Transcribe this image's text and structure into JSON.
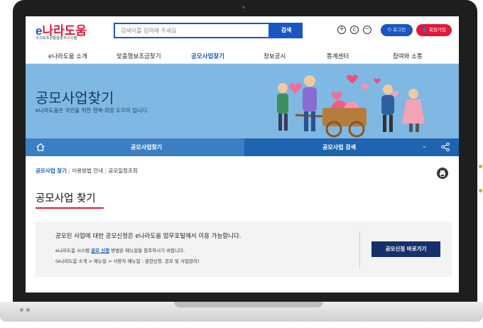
{
  "header": {
    "logo_e": "e",
    "logo_rest": "나라도움",
    "logo_sub": "국고보조금통합관리시스템",
    "search_placeholder": "검색어를 입력해 주세요",
    "search_button": "검색",
    "zoom_in": "+",
    "zoom_reset": "C",
    "zoom_out": "−",
    "login_label": "로그인",
    "join_label": "회원가입"
  },
  "gnb": {
    "items": [
      {
        "label": "e나라도움 소개"
      },
      {
        "label": "맞춤형보조금찾기"
      },
      {
        "label": "공모사업찾기"
      },
      {
        "label": "정보공시"
      },
      {
        "label": "통계센터"
      },
      {
        "label": "참여와 소통"
      }
    ],
    "active_index": 2
  },
  "banner": {
    "title": "공모사업찾기",
    "subtitle": "e나라도움은 국민을 위한 행복·희망 도우미 입니다."
  },
  "subnav": {
    "left_label": "공모사업찾기",
    "right_label": "공모사업 검색"
  },
  "breadcrumb": {
    "active": "공모사업 찾기",
    "item2": "이용방법 안내",
    "item3": "공모일정조회"
  },
  "page": {
    "title": "공모사업 찾기"
  },
  "info": {
    "line1": "공모된 사업에 대한 공모신청은 e나라도움 업무포털에서 이용 가능합니다.",
    "line2_pre": "e나라도움 시스템 ",
    "line2_link": "공모 신청",
    "line2_post": " 방법은 매뉴얼을 참조하시기 바랍니다.",
    "line3": "(e나라도움 소개 > 매뉴얼 > 사용자 매뉴얼 : 권한신청, 공모 및 사업관리)",
    "apply_button": "공모신청 바로가기"
  },
  "colors": {
    "brand_blue": "#1a56c4",
    "brand_red": "#e0193a",
    "banner_bg": "#7fb8e2",
    "subnav_bg": "#3a7fc4",
    "button_navy": "#16306b"
  }
}
